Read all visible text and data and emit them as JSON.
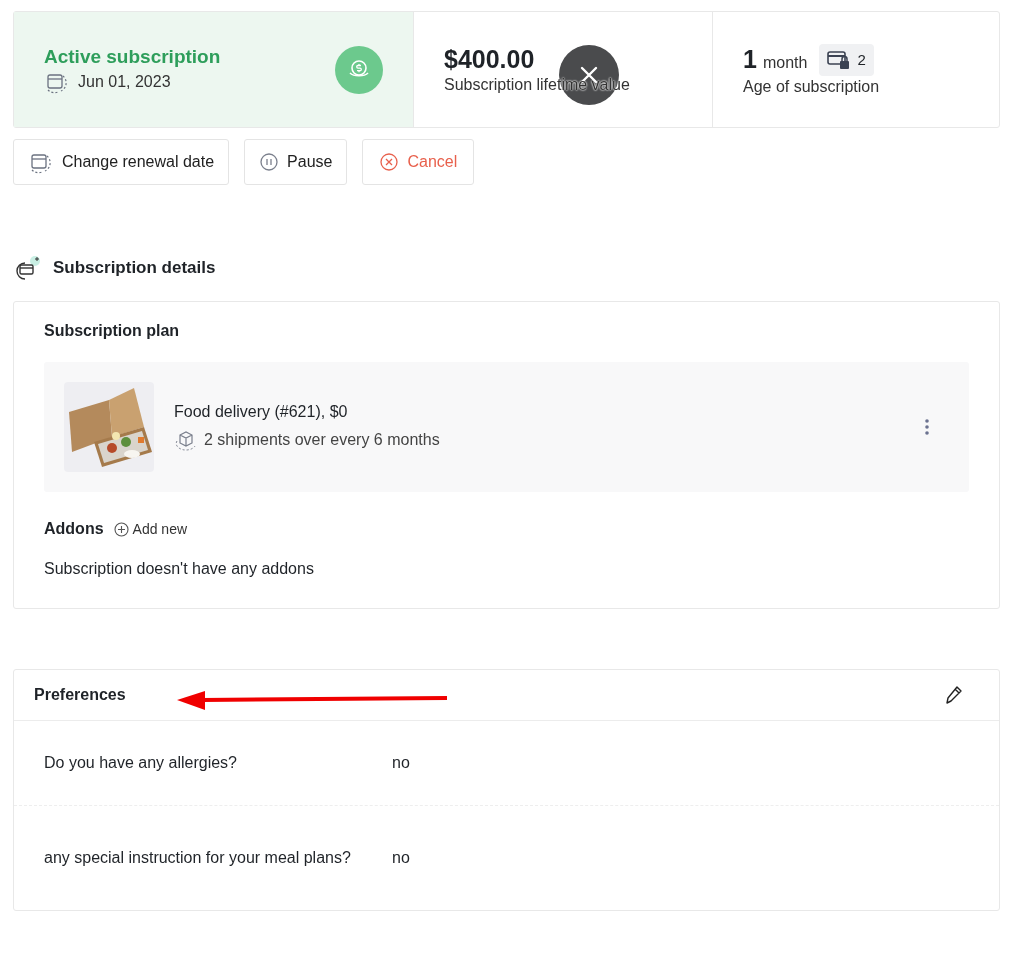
{
  "summary": {
    "status": {
      "title": "Active subscription",
      "date": "Jun 01, 2023"
    },
    "lifetime": {
      "value": "$400.00",
      "label": "Subscription lifetime value"
    },
    "age": {
      "number": "1",
      "unit": "month",
      "badge_count": "2",
      "label": "Age of subscription"
    }
  },
  "actions": [
    {
      "kind": "renewal",
      "label": "Change renewal date"
    },
    {
      "kind": "pause",
      "label": "Pause"
    },
    {
      "kind": "cancel",
      "label": "Cancel"
    }
  ],
  "details": {
    "title": "Subscription details",
    "plan_title": "Subscription plan",
    "plan": {
      "kind": "picture",
      "name": "Food delivery (#621), $0",
      "schedule": "2 shipments over every 6 months"
    },
    "addons_title": "Addons",
    "add_new": "Add new",
    "addons_empty": "Subscription doesn't have any addons"
  },
  "preferences": {
    "title": "Preferences",
    "rows": [
      {
        "question": "Do you have any allergies?",
        "answer": "no"
      },
      {
        "question": "any special instruction for your meal plans?",
        "answer": "no"
      }
    ]
  }
}
